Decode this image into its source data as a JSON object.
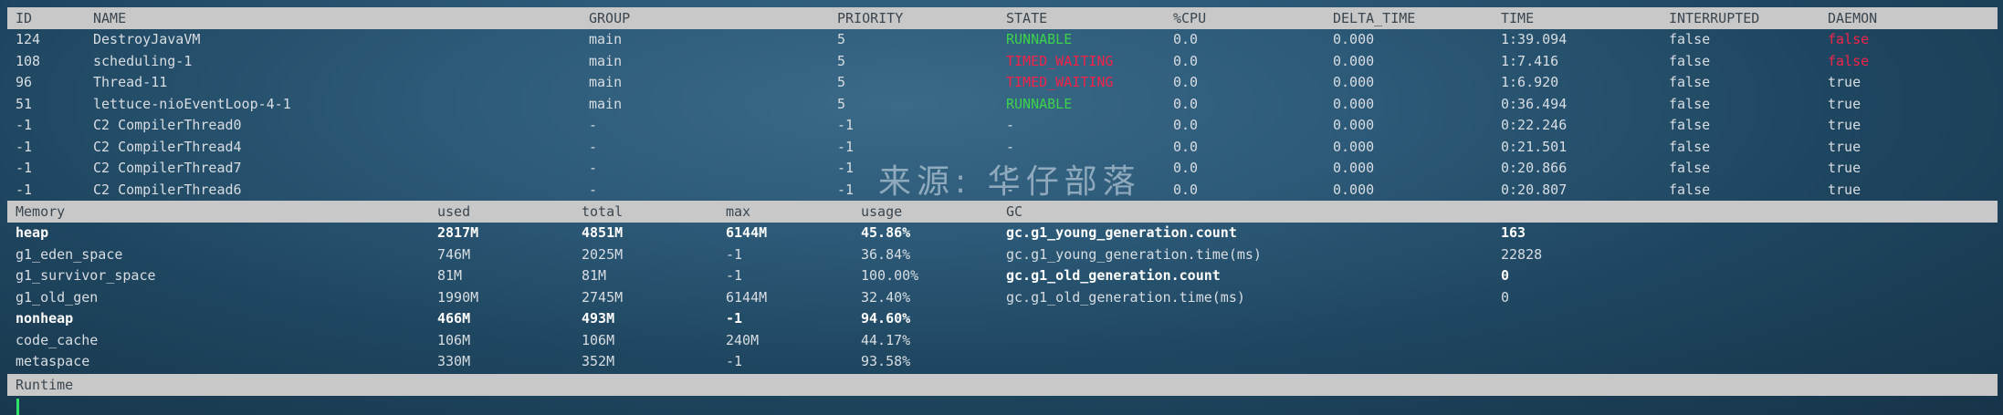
{
  "threads": {
    "headers": [
      "ID",
      "NAME",
      "GROUP",
      "PRIORITY",
      "STATE",
      "%CPU",
      "DELTA_TIME",
      "TIME",
      "INTERRUPTED",
      "DAEMON"
    ],
    "rows": [
      {
        "id": "124",
        "name": "DestroyJavaVM",
        "group": "main",
        "priority": "5",
        "state": "RUNNABLE",
        "state_color": "green",
        "cpu": "0.0",
        "delta": "0.000",
        "time": "1:39.094",
        "interrupted": "false",
        "daemon": "false",
        "daemon_color": "red"
      },
      {
        "id": "108",
        "name": "scheduling-1",
        "group": "main",
        "priority": "5",
        "state": "TIMED_WAITING",
        "state_color": "red",
        "cpu": "0.0",
        "delta": "0.000",
        "time": "1:7.416",
        "interrupted": "false",
        "daemon": "false",
        "daemon_color": "red"
      },
      {
        "id": "96",
        "name": "Thread-11",
        "group": "main",
        "priority": "5",
        "state": "TIMED_WAITING",
        "state_color": "red",
        "cpu": "0.0",
        "delta": "0.000",
        "time": "1:6.920",
        "interrupted": "false",
        "daemon": "true",
        "daemon_color": ""
      },
      {
        "id": "51",
        "name": "lettuce-nioEventLoop-4-1",
        "group": "main",
        "priority": "5",
        "state": "RUNNABLE",
        "state_color": "green",
        "cpu": "0.0",
        "delta": "0.000",
        "time": "0:36.494",
        "interrupted": "false",
        "daemon": "true",
        "daemon_color": ""
      },
      {
        "id": "-1",
        "name": "C2 CompilerThread0",
        "group": "-",
        "priority": "-1",
        "state": "-",
        "state_color": "",
        "cpu": "0.0",
        "delta": "0.000",
        "time": "0:22.246",
        "interrupted": "false",
        "daemon": "true",
        "daemon_color": ""
      },
      {
        "id": "-1",
        "name": "C2 CompilerThread4",
        "group": "-",
        "priority": "-1",
        "state": "-",
        "state_color": "",
        "cpu": "0.0",
        "delta": "0.000",
        "time": "0:21.501",
        "interrupted": "false",
        "daemon": "true",
        "daemon_color": ""
      },
      {
        "id": "-1",
        "name": "C2 CompilerThread7",
        "group": "-",
        "priority": "-1",
        "state": "-",
        "state_color": "",
        "cpu": "0.0",
        "delta": "0.000",
        "time": "0:20.866",
        "interrupted": "false",
        "daemon": "true",
        "daemon_color": ""
      },
      {
        "id": "-1",
        "name": "C2 CompilerThread6",
        "group": "-",
        "priority": "-1",
        "state": "-",
        "state_color": "",
        "cpu": "0.0",
        "delta": "0.000",
        "time": "0:20.807",
        "interrupted": "false",
        "daemon": "true",
        "daemon_color": ""
      }
    ]
  },
  "memory": {
    "headers": [
      "Memory",
      "used",
      "total",
      "max",
      "usage",
      "GC"
    ],
    "rows": [
      {
        "name": "heap",
        "used": "2817M",
        "total": "4851M",
        "max": "6144M",
        "usage": "45.86%",
        "bold": true,
        "gc_name": "gc.g1_young_generation.count",
        "gc_value": "163",
        "gc_bold": true
      },
      {
        "name": "g1_eden_space",
        "used": "746M",
        "total": "2025M",
        "max": "-1",
        "usage": "36.84%",
        "bold": false,
        "gc_name": "gc.g1_young_generation.time(ms)",
        "gc_value": "22828",
        "gc_bold": false
      },
      {
        "name": "g1_survivor_space",
        "used": "81M",
        "total": "81M",
        "max": "-1",
        "usage": "100.00%",
        "bold": false,
        "gc_name": "gc.g1_old_generation.count",
        "gc_value": "0",
        "gc_bold": true
      },
      {
        "name": "g1_old_gen",
        "used": "1990M",
        "total": "2745M",
        "max": "6144M",
        "usage": "32.40%",
        "bold": false,
        "gc_name": "gc.g1_old_generation.time(ms)",
        "gc_value": "0",
        "gc_bold": false
      },
      {
        "name": "nonheap",
        "used": "466M",
        "total": "493M",
        "max": "-1",
        "usage": "94.60%",
        "bold": true,
        "gc_name": "",
        "gc_value": "",
        "gc_bold": false
      },
      {
        "name": "code_cache",
        "used": "106M",
        "total": "106M",
        "max": "240M",
        "usage": "44.17%",
        "bold": false,
        "gc_name": "",
        "gc_value": "",
        "gc_bold": false
      },
      {
        "name": "metaspace",
        "used": "330M",
        "total": "352M",
        "max": "-1",
        "usage": "93.58%",
        "bold": false,
        "gc_name": "",
        "gc_value": "",
        "gc_bold": false
      }
    ]
  },
  "runtime": {
    "header": "Runtime"
  },
  "watermark": "来源: 华仔部落",
  "colors": {
    "header_band": "#c8c8c8",
    "runnable": "#3cd24a",
    "waiting": "#f2224a",
    "cursor": "#2fe06a"
  }
}
